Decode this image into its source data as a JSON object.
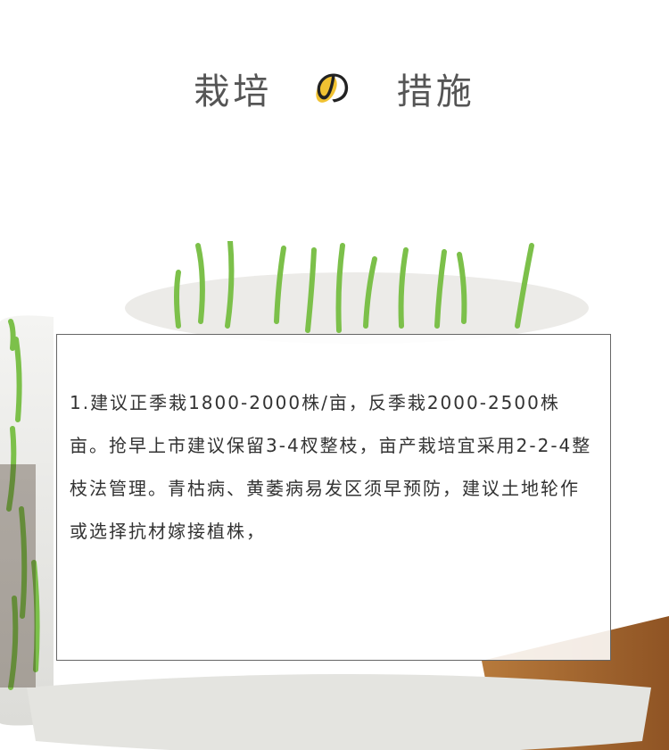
{
  "header": {
    "title_left": "栽培",
    "title_mid": "の",
    "title_right": "措施"
  },
  "content": {
    "paragraph": "1.建议正季栽1800-2000株/亩，反季栽2000-2500株亩。抢早上市建议保留3-4杈整枝，亩产栽培宜采用2-2-4整枝法管理。青枯病、黄萎病易发区须早预防，建议土地轮作或选择抗材嫁接植株，"
  },
  "colors": {
    "accent": "#f1c232",
    "title_text": "#555555",
    "body_text": "#333333",
    "grass": "#7cc04a"
  }
}
